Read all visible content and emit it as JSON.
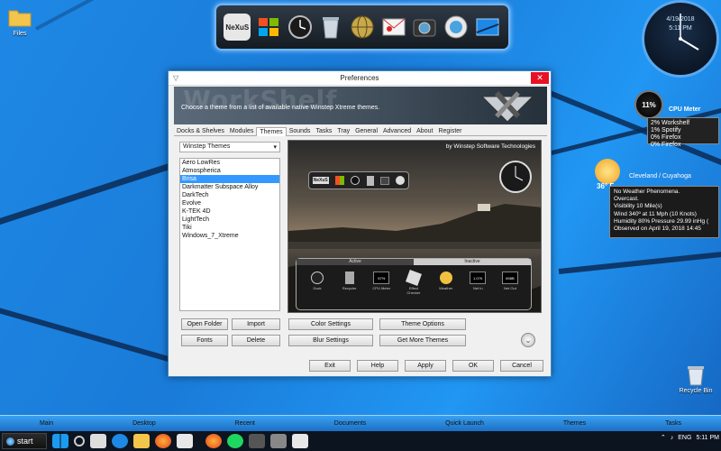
{
  "desktop": {
    "icons": [
      {
        "label": "Files"
      },
      {
        "label": "Recycle Bin"
      }
    ]
  },
  "top_dock": {
    "items": [
      "nexus-logo",
      "windows-logo",
      "clock",
      "recycle-bin",
      "nexus-sphere",
      "mail",
      "camera",
      "globe",
      "desktop"
    ],
    "logo_text": "NeXuS"
  },
  "clock_widget": {
    "date": "4/19/2018",
    "time": "5:11 PM"
  },
  "cpu_meter": {
    "percent": "11%",
    "title": "CPU Meter",
    "processes": [
      "2% Workshelf",
      "1% Spotify",
      "0% Firefox",
      "0% Firefox"
    ]
  },
  "weather": {
    "temp": "36° F",
    "city": "Cleveland / Cuyahoga",
    "lines": [
      "No Weather Phenomena.",
      "Overcast.",
      "Visibility 10 Mile(s)",
      "Wind 340º at 11 Mph (10 Knots)",
      "Humidity 80%     Pressure 29.99 inHg (",
      "Observed on April 19, 2018 14:45"
    ]
  },
  "window": {
    "title": "Preferences",
    "banner_watermark": "WorkShelf",
    "banner_text": "Choose a theme from a list of available native Winstep Xtreme themes.",
    "tabs": [
      "Docks & Shelves",
      "Modules",
      "Themes",
      "Sounds",
      "Tasks",
      "Tray",
      "General",
      "Advanced",
      "About",
      "Register"
    ],
    "active_tab": "Themes",
    "theme_select": "Winstep Themes",
    "themes": [
      "Aero LowRes",
      "Atmospherica",
      "Brisa",
      "Darkmatter Subspace Alloy",
      "DarkTech",
      "Evolve",
      "K-TEK 4D",
      "LightTech",
      "Tiki",
      "Windows_7_Xtreme"
    ],
    "selected_theme": "Brisa",
    "preview_credit": "by Winstep Software Technologies",
    "preview_labels": {
      "active": "Active",
      "inactive": "Inactive",
      "slot_labels": [
        "Dock",
        "Recycler",
        "CPU Meter",
        "Effect Checker",
        "Weather",
        "Net In",
        "Net Out"
      ],
      "slot_values": [
        "57%",
        "1.07K",
        "898B"
      ],
      "dock_logo": "NeXuS"
    },
    "buttons": {
      "open_folder": "Open Folder",
      "import": "Import",
      "fonts": "Fonts",
      "delete": "Delete",
      "color_settings": "Color Settings",
      "blur_settings": "Blur Settings",
      "theme_options": "Theme Options",
      "get_more_themes": "Get More Themes",
      "exit": "Exit",
      "help": "Help",
      "apply": "Apply",
      "ok": "OK",
      "cancel": "Cancel"
    }
  },
  "bottom_dock": {
    "items": [
      "Main",
      "Desktop",
      "Recent",
      "Documents",
      "Quick Launch",
      "Themes",
      "Tasks"
    ]
  },
  "taskbar": {
    "start_label": "start",
    "tray_time": "5:11 PM",
    "tray_lang": "ENG"
  },
  "colors": {
    "accent": "#3399ff",
    "close": "#e81123",
    "desktop": "#1f7fd6"
  }
}
